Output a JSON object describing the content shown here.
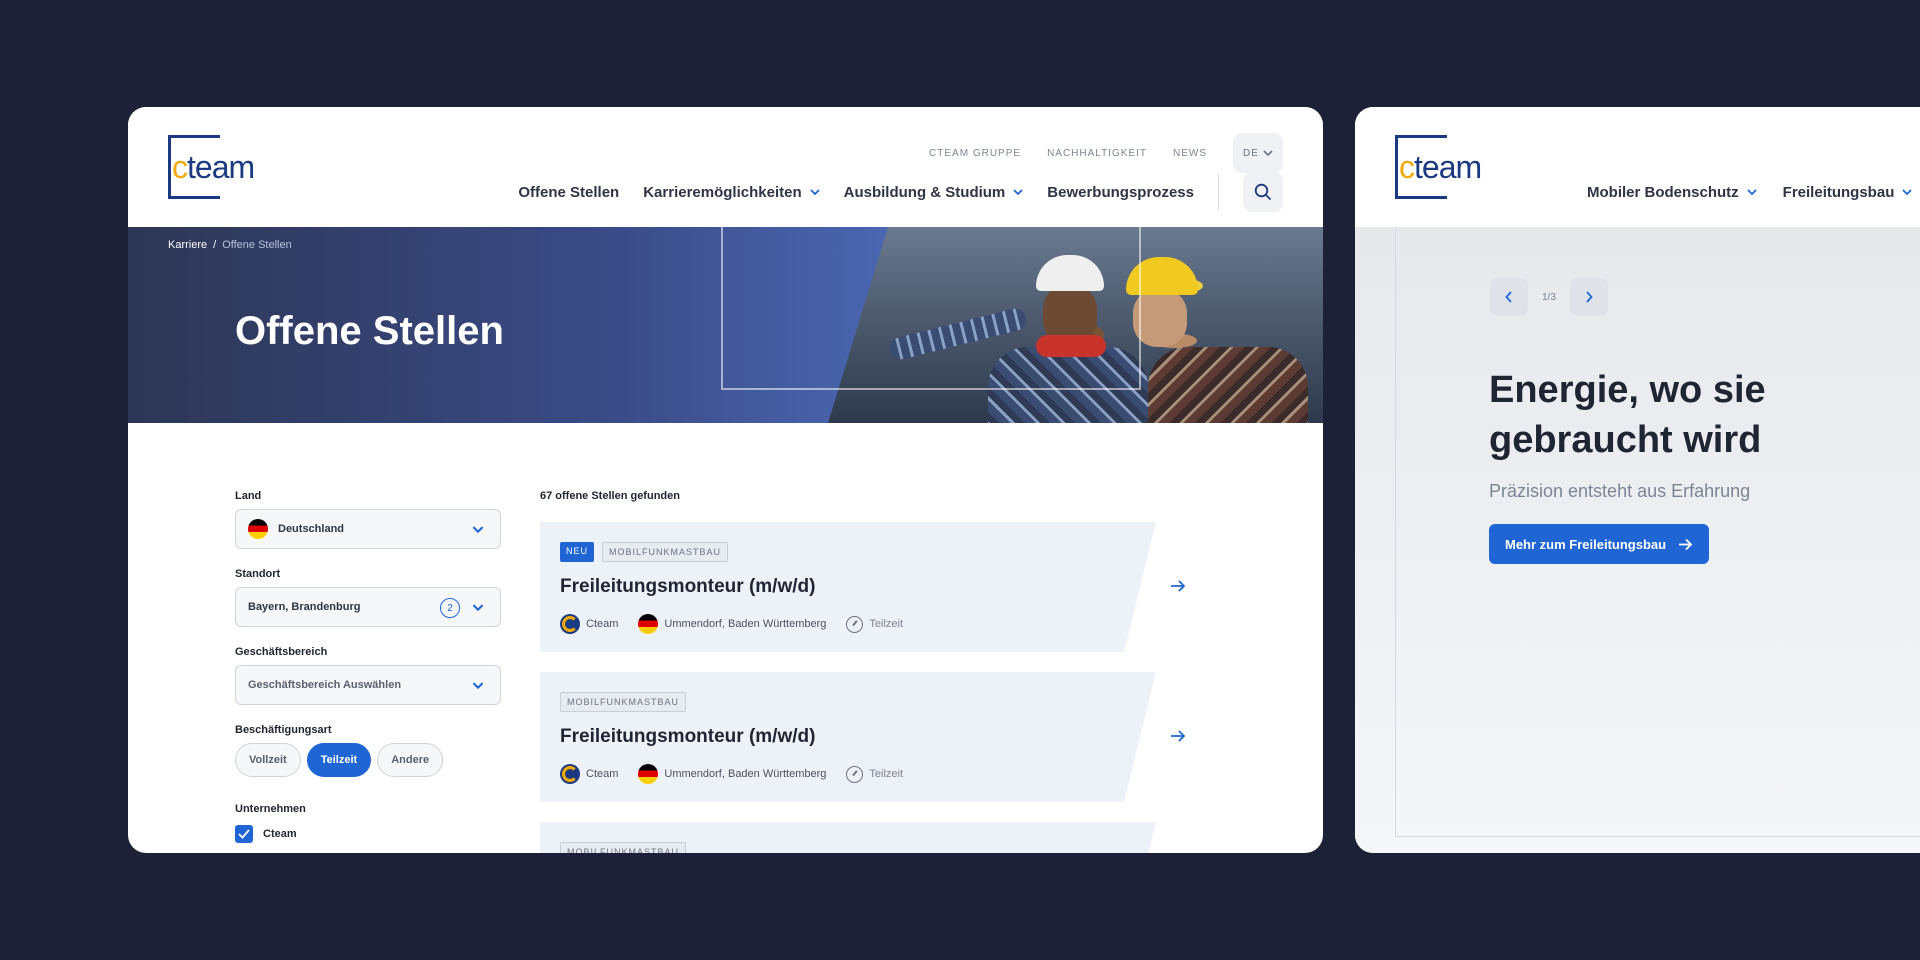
{
  "brand": {
    "logo_c": "c",
    "logo_rest": "team"
  },
  "main": {
    "topnav": [
      "CTEAM GRUPPE",
      "NACHHALTIGKEIT",
      "NEWS"
    ],
    "lang": "DE",
    "nav": [
      {
        "label": "Offene Stellen",
        "dropdown": false
      },
      {
        "label": "Karrieremöglichkeiten",
        "dropdown": true
      },
      {
        "label": "Ausbildung & Studium",
        "dropdown": true
      },
      {
        "label": "Bewerbungsprozess",
        "dropdown": false
      }
    ],
    "breadcrumb": {
      "root": "Karriere",
      "sep": "/",
      "current": "Offene Stellen"
    },
    "hero_title": "Offene Stellen",
    "filters": {
      "land_label": "Land",
      "land_value": "Deutschland",
      "standort_label": "Standort",
      "standort_value": "Bayern, Brandenburg",
      "standort_count": "2",
      "bereich_label": "Geschäftsbereich",
      "bereich_placeholder": "Geschäftsbereich Auswählen",
      "art_label": "Beschäftigungsart",
      "art_options": [
        "Vollzeit",
        "Teilzeit",
        "Andere"
      ],
      "art_selected": "Teilzeit",
      "unternehmen_label": "Unternehmen",
      "unternehmen_option": "Cteam",
      "unternehmen_checked": true
    },
    "results_text": "67 offene Stellen gefunden",
    "jobs": [
      {
        "new_tag": "NEU",
        "category": "MOBILFUNKMASTBAU",
        "title": "Freileitungsmonteur (m/w/d)",
        "company": "Cteam",
        "location": "Ummendorf, Baden Württemberg",
        "type": "Teilzeit"
      },
      {
        "new_tag": "",
        "category": "MOBILFUNKMASTBAU",
        "title": "Freileitungsmonteur (m/w/d)",
        "company": "Cteam",
        "location": "Ummendorf, Baden Württemberg",
        "type": "Teilzeit"
      },
      {
        "new_tag": "",
        "category": "MOBILFUNKMASTBAU",
        "title": "",
        "company": "",
        "location": "",
        "type": ""
      }
    ]
  },
  "side": {
    "nav": [
      "Mobiler Bodenschutz",
      "Freileitungsbau"
    ],
    "slide_count": "1/3",
    "title": "Energie, wo sie gebraucht wird",
    "subtitle": "Präzision entsteht aus Erfahrung",
    "cta": "Mehr zum Freileitungsbau"
  },
  "colors": {
    "background": "#1c2137",
    "accent": "#1f66d4",
    "brand_blue": "#1b3a82",
    "brand_yellow": "#f2a900"
  }
}
